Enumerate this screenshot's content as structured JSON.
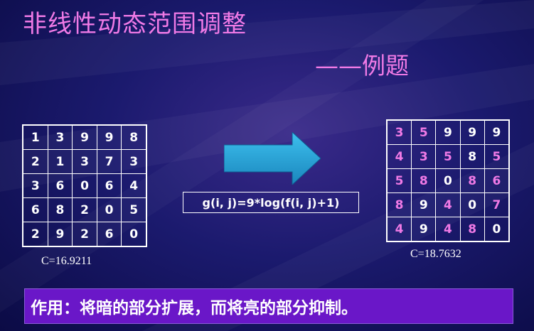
{
  "slide": {
    "title": "非线性动态范围调整",
    "subtitle": "——例题",
    "formula": "g(i, j)=9*log(f(i, j)+1)",
    "effect": "作用：将暗的部分扩展，而将亮的部分抑制。",
    "left_c": "C=16.9211",
    "right_c": "C=18.7632"
  },
  "input_matrix": [
    [
      "1",
      "3",
      "9",
      "9",
      "8"
    ],
    [
      "2",
      "1",
      "3",
      "7",
      "3"
    ],
    [
      "3",
      "6",
      "0",
      "6",
      "4"
    ],
    [
      "6",
      "8",
      "2",
      "0",
      "5"
    ],
    [
      "2",
      "9",
      "2",
      "6",
      "0"
    ]
  ],
  "output_matrix": [
    [
      "3",
      "5",
      "9",
      "9",
      "9"
    ],
    [
      "4",
      "3",
      "5",
      "8",
      "5"
    ],
    [
      "5",
      "8",
      "0",
      "8",
      "6"
    ],
    [
      "8",
      "9",
      "4",
      "0",
      "7"
    ],
    [
      "4",
      "9",
      "4",
      "8",
      "0"
    ]
  ],
  "output_changed": [
    [
      1,
      1,
      0,
      0,
      0
    ],
    [
      1,
      1,
      1,
      0,
      1
    ],
    [
      1,
      1,
      0,
      1,
      1
    ],
    [
      1,
      0,
      1,
      0,
      1
    ],
    [
      1,
      0,
      1,
      1,
      0
    ]
  ],
  "colors": {
    "title": "#f07ae6",
    "changed": "#f07ae6",
    "unchanged": "#ffffff",
    "effect_bg": "#6a17c8",
    "arrow": "#2aa6d6"
  }
}
